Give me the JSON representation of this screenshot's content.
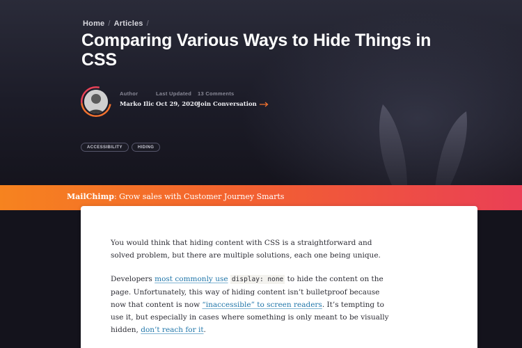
{
  "breadcrumb": {
    "items": [
      "Home",
      "Articles"
    ],
    "separator": "/"
  },
  "article": {
    "title": "Comparing Various Ways to Hide Things in CSS",
    "author_label": "Author",
    "author_name": "Marko Ilic",
    "updated_label": "Last Updated",
    "updated_value": "Oct 29, 2020",
    "comments_label": "13 Comments",
    "comments_link": "Join Conversation",
    "tags": [
      "ACCESSIBILITY",
      "HIDING"
    ]
  },
  "sponsor": {
    "brand": "MailChimp",
    "text": ": Grow sales with Customer Journey Smarts"
  },
  "body": {
    "p1": "You would think that hiding content with CSS is a straightforward and solved problem, but there are multiple solutions, each one being unique.",
    "p2_a": "Developers ",
    "p2_link1": "most commonly use",
    "p2_b": " ",
    "p2_code": "display: none",
    "p2_c": " to hide the content on the page. Unfortunately, this way of hiding content isn’t bulletproof because now that content is now ",
    "p2_link2": "“inaccessible” to screen readers",
    "p2_d": ". It’s tempting to use it, but especially in cases where something is only meant to be visually hidden, ",
    "p2_link3": "don’t reach for it",
    "p2_e": "."
  },
  "colors": {
    "accent_orange": "#f6831f",
    "accent_pink": "#ea3f55",
    "link_blue": "#2277aa",
    "hero_bg": "#1c1c28"
  },
  "icons": {
    "arrow": "arrow-right-icon",
    "ears": "rabbit-ears-decoration"
  }
}
